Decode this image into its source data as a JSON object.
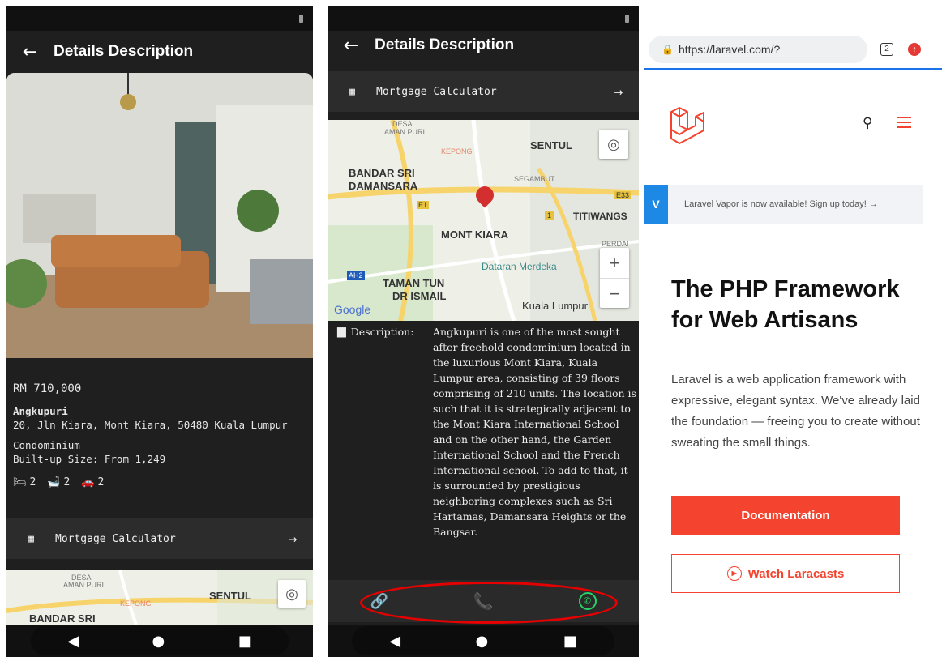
{
  "panel1": {
    "title": "Details Description",
    "price": "RM 710,000",
    "name": "Angkupuri",
    "address": "20, Jln Kiara, Mont Kiara, 50480 Kuala Lumpur",
    "type": "Condominium",
    "size": "Built-up Size: From 1,249",
    "beds": "2",
    "baths": "2",
    "parking": "2",
    "mortgage_label": "Mortgage Calculator",
    "map": {
      "desa": "DESA",
      "amanpuri": "AMAN PURI",
      "kepong": "KEPONG",
      "sentul": "SENTUL",
      "bandar": "BANDAR SRI"
    }
  },
  "panel2": {
    "title": "Details Description",
    "mortgage_label": "Mortgage Calculator",
    "map": {
      "desa": "DESA",
      "amanpuri": "AMAN PURI",
      "kepong": "KEPONG",
      "sentul": "SENTUL",
      "bandar": "BANDAR SRI",
      "damansara": "DAMANSARA",
      "segambut": "SEGAMBUT",
      "e33": "E33",
      "e1": "E1",
      "road1": "1",
      "titiwangsa": "TITIWANGS",
      "montkiara": "MONT KIARA",
      "perdana": "PERDAI",
      "dataran": "Dataran Merdeka",
      "ah2": "AH2",
      "taman": "TAMAN TUN",
      "drismail": "DR ISMAIL",
      "kl": "Kuala Lumpur",
      "google": "Google",
      "zoom_in": "+",
      "zoom_out": "−"
    },
    "desc_label": "Description:",
    "desc_text": "Angkupuri is one of the most sought after freehold condominium located in the luxurious Mont Kiara, Kuala Lumpur area, consisting of 39 floors comprising of 210 units. The location is such that it is strategically adjacent to the Mont Kiara International School and on the other hand, the Garden International School and the French International school. To add to that, it is surrounded by prestigious neighboring complexes such as Sri Hartamas, Damansara Heights or the Bangsar."
  },
  "panel3": {
    "url": "https://laravel.com/?",
    "tab_count": "2",
    "banner": "Laravel Vapor is now available! Sign up today! →",
    "vapor_logo": "V",
    "hero": "The PHP Framework for Web Artisans",
    "lead": "Laravel is a web application framework with expressive, elegant syntax. We've already laid the foundation — freeing you to create without sweating the small things.",
    "doc_button": "Documentation",
    "cast_button": "Watch Laracasts"
  },
  "colors": {
    "dark_bg": "#1f1f1f",
    "laravel_red": "#f4442f",
    "whatsapp_green": "#25d366",
    "phone_blue": "#1e88e5",
    "highlight_red": "#e60000"
  }
}
